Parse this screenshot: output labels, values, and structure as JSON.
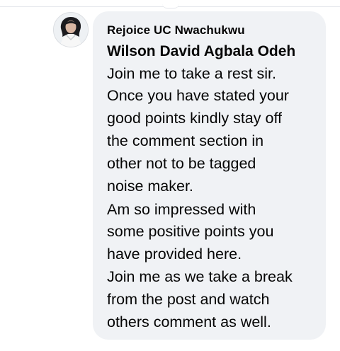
{
  "comment": {
    "author_name": "Rejoice UC Nwachukwu",
    "mention": "Wilson David Agbala Odeh",
    "lines": [
      "Join me to take a rest sir.",
      "Once you have stated your",
      "good points kindly stay off",
      "the comment section in",
      "other not to be tagged",
      "noise maker.",
      "Am so impressed with",
      "some positive points you",
      "have provided here.",
      "Join me as we take a break",
      "from the post and watch",
      "others comment as well."
    ]
  },
  "icons": {
    "avatar": "profile-photo"
  },
  "colors": {
    "bubble_background": "#f0f2f5",
    "text": "#050505"
  }
}
